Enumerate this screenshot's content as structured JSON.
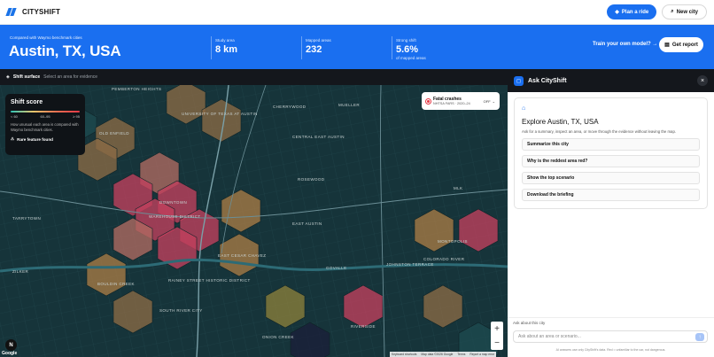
{
  "app": {
    "name": "CITYSHIFT"
  },
  "topbar": {
    "plan_ride": "Plan a ride",
    "new_city": "New city"
  },
  "hero": {
    "eyebrow": "Compared with Waymo benchmark cities",
    "city": "Austin, TX, USA",
    "stats": [
      {
        "label": "Study area",
        "value": "8 km",
        "sub": ""
      },
      {
        "label": "Mapped areas",
        "value": "232",
        "sub": ""
      },
      {
        "label": "Strong shift",
        "value": "5.6%",
        "sub": "of mapped areas"
      }
    ],
    "train_label": "Train your own model? →",
    "report_label": "Get report"
  },
  "subbar": {
    "title": "Shift surface",
    "hint": "Select an area for evidence"
  },
  "score_card": {
    "title": "Shift score",
    "ticks": [
      "< 60",
      "60–95",
      "≥ 95"
    ],
    "desc": "How unusual each area is compared with Waymo benchmark cities.",
    "rare": "Rare feature found"
  },
  "fatal": {
    "title": "Fatal crashes",
    "sub": "NHTSA FARS · 2020–24",
    "toggle": "OFF"
  },
  "map_labels": {
    "pemberton": "PEMBERTON HEIGHTS",
    "university": "UNIVERSITY OF TEXAS AT AUSTIN",
    "cherrywood": "CHERRYWOOD",
    "mueller": "MUELLER",
    "windsor": "WINDSOR PARK",
    "oldenfield": "OLD ENFIELD",
    "central_east": "CENTRAL EAST AUSTIN",
    "bluffington": "BLUFFINGTON",
    "downtown": "DOWNTOWN",
    "warehouse": "WAREHOUSE DISTRICT",
    "rosewood": "ROSEWOOD",
    "mlk": "MLK",
    "east_austin": "EAST AUSTIN",
    "rainey": "RAINEY STREET HISTORIC DISTRICT",
    "east_cesar": "EAST CESAR CHAVEZ",
    "govalle": "GOVALLE",
    "johnston": "JOHNSTON TERRACE",
    "montopolis": "MONTOPOLIS",
    "bouldin": "BOULDIN CREEK",
    "south_river": "SOUTH RIVER CITY",
    "riverside": "RIVERSIDE",
    "colorado": "COLORADO RIVER",
    "zilker": "ZILKER",
    "tarrytown": "TARRYTOWN",
    "hyde": "HYDE PARK",
    "onion": "ONION CREEK"
  },
  "map_ui": {
    "google": "Google",
    "attribution": [
      "Keyboard shortcuts",
      "Map data ©2026 Google",
      "Terms",
      "Report a map error"
    ],
    "zoom_in": "+",
    "zoom_out": "−",
    "n_badge": "N"
  },
  "panel": {
    "title": "Ask CityShift",
    "card_title": "Explore Austin, TX, USA",
    "card_desc": "Ask for a summary, inspect an area, or move through the evidence without leaving the map.",
    "suggestions": [
      "Summarize this city",
      "Why is the reddest area red?",
      "Show the top scenario",
      "Download the briefing"
    ],
    "ask_label": "Ask about this city",
    "placeholder": "Ask about an area or scenario...",
    "footer": "AI answers use only CityShift's data. Red = unfamiliar to the car, not dangerous."
  },
  "colors": {
    "accent": "#1a6ff0",
    "map_bg": "#16343a",
    "hot": "#c2405e",
    "warm": "#b07a45",
    "cool": "#2a6e73"
  }
}
